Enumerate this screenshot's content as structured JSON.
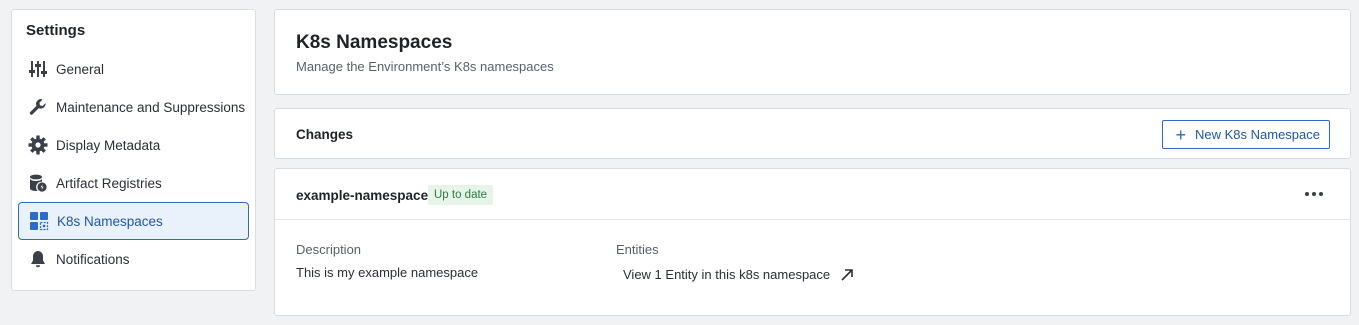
{
  "sidebar": {
    "title": "Settings",
    "items": [
      {
        "label": "General",
        "icon": "sliders-icon"
      },
      {
        "label": "Maintenance and Suppressions",
        "icon": "wrench-icon"
      },
      {
        "label": "Display Metadata",
        "icon": "gear-icon"
      },
      {
        "label": "Artifact Registries",
        "icon": "database-icon"
      },
      {
        "label": "K8s Namespaces",
        "icon": "grid-icon",
        "active": true
      },
      {
        "label": "Notifications",
        "icon": "bell-icon"
      }
    ]
  },
  "header": {
    "title": "K8s Namespaces",
    "subtitle": "Manage the Environment’s K8s namespaces"
  },
  "changes": {
    "title": "Changes",
    "new_button_label": "New K8s Namespace"
  },
  "namespace": {
    "name": "example-namespace",
    "status": "Up to date",
    "description_label": "Description",
    "description": "This is my example namespace",
    "entities_label": "Entities",
    "entities_link": "View 1 Entity in this k8s namespace"
  },
  "colors": {
    "accent": "#2d6bc4",
    "status_bg": "#e7f4ea",
    "status_text": "#2f7a3e"
  }
}
